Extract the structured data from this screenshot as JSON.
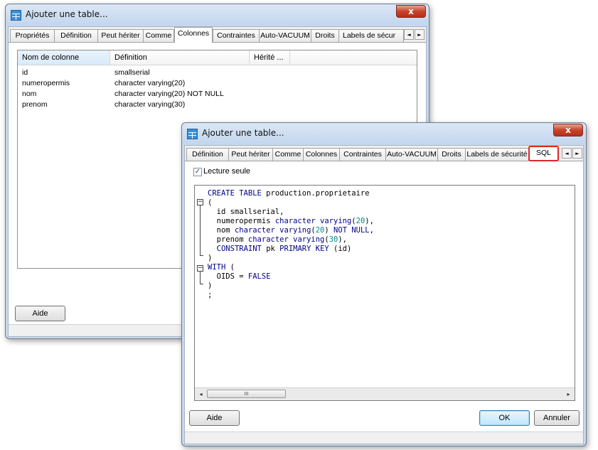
{
  "back_window": {
    "title": "Ajouter une table...",
    "close_label": "x",
    "tabs": [
      "Propriétés",
      "Définition",
      "Peut hériter",
      "Comme",
      "Colonnes",
      "Contraintes",
      "Auto-VACUUM",
      "Droits",
      "Labels de sécur"
    ],
    "active_tab": "Colonnes",
    "columns_header": [
      "Nom de colonne",
      "Définition",
      "Hérité ..."
    ],
    "rows": [
      {
        "name": "id",
        "definition": "smallserial",
        "inherited": ""
      },
      {
        "name": "numeropermis",
        "definition": "character varying(20)",
        "inherited": ""
      },
      {
        "name": "nom",
        "definition": "character varying(20) NOT NULL",
        "inherited": ""
      },
      {
        "name": "prenom",
        "definition": "character varying(30)",
        "inherited": ""
      }
    ],
    "help_label": "Aide"
  },
  "front_window": {
    "title": "Ajouter une table...",
    "close_label": "x",
    "tabs": [
      "Définition",
      "Peut hériter",
      "Comme",
      "Colonnes",
      "Contraintes",
      "Auto-VACUUM",
      "Droits",
      "Labels de sécurité",
      "SQL"
    ],
    "active_tab": "SQL",
    "readonly_label": "Lecture seule",
    "readonly_checked": true,
    "sql_lines": [
      "CREATE TABLE production.proprietaire",
      "(",
      "  id smallserial,",
      "  numeropermis character varying(20),",
      "  nom character varying(20) NOT NULL,",
      "  prenom character varying(30),",
      "  CONSTRAINT pk PRIMARY KEY (id)",
      ")",
      "WITH (",
      "  OIDS = FALSE",
      ")",
      ";"
    ],
    "scroll_thumb_label": "III",
    "help_label": "Aide",
    "ok_label": "OK",
    "cancel_label": "Annuler"
  },
  "colors": {
    "tab_highlight": "#e0262a",
    "sql_keyword": "#00008b",
    "sql_number": "#008c8c",
    "window_frame": "#c9d9ec"
  }
}
